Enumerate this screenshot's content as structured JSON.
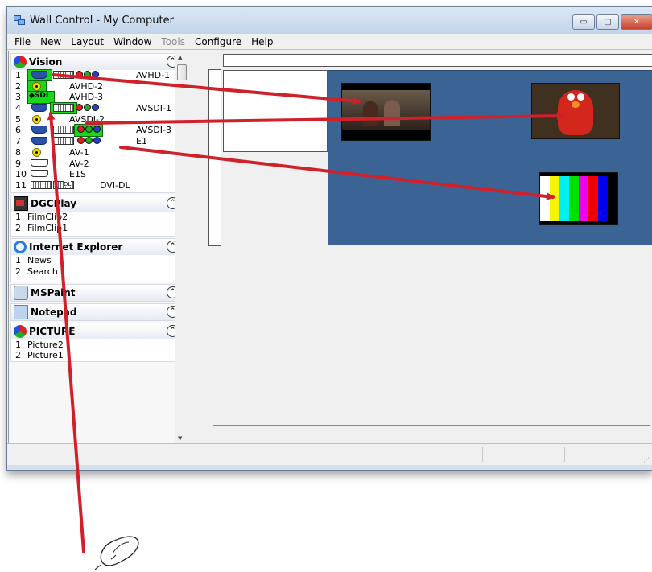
{
  "window": {
    "title": "Wall Control - My Computer",
    "minimize": "▭",
    "maximize": "▢",
    "close": "✕"
  },
  "menu": [
    {
      "label": "File",
      "disabled": false
    },
    {
      "label": "New",
      "disabled": false
    },
    {
      "label": "Layout",
      "disabled": false
    },
    {
      "label": "Window",
      "disabled": false
    },
    {
      "label": "Tools",
      "disabled": true
    },
    {
      "label": "Configure",
      "disabled": false
    },
    {
      "label": "Help",
      "disabled": false
    }
  ],
  "groups": {
    "vision": {
      "title": "Vision",
      "icon": "rgb-circle-icon",
      "collapse": "⌃",
      "items": [
        {
          "n": "1",
          "label": "AVHD-1"
        },
        {
          "n": "2",
          "label": "AVHD-2"
        },
        {
          "n": "3",
          "label": "AVHD-3",
          "tag": "SDI"
        },
        {
          "n": "4",
          "label": "AVSDI-1"
        },
        {
          "n": "5",
          "label": "AVSDI-2"
        },
        {
          "n": "6",
          "label": "AVSDI-3"
        },
        {
          "n": "7",
          "label": "E1"
        },
        {
          "n": "8",
          "label": "AV-1"
        },
        {
          "n": "9",
          "label": "AV-2"
        },
        {
          "n": "10",
          "label": "E1S"
        },
        {
          "n": "11",
          "label": "DVI-DL",
          "tag": "DL"
        }
      ]
    },
    "dgcplay": {
      "title": "DGCPlay",
      "icon": "film-icon",
      "collapse": "⌃",
      "items": [
        {
          "n": "1",
          "label": "FilmClip2"
        },
        {
          "n": "2",
          "label": "FilmClip1"
        }
      ]
    },
    "ie": {
      "title": "Internet Explorer",
      "icon": "internet-explorer-icon",
      "collapse": "⌃",
      "items": [
        {
          "n": "1",
          "label": "News"
        },
        {
          "n": "2",
          "label": "Search"
        }
      ]
    },
    "mspaint": {
      "title": "MSPaint",
      "icon": "paint-icon",
      "collapse": "⌃"
    },
    "notepad": {
      "title": "Notepad",
      "icon": "notepad-icon",
      "collapse": "⌃"
    },
    "picture": {
      "title": "PICTURE",
      "icon": "rgb-circle-icon",
      "collapse": "⌃",
      "items": [
        {
          "n": "1",
          "label": "Picture2"
        },
        {
          "n": "2",
          "label": "Picture1"
        }
      ]
    }
  },
  "colors": {
    "arrow": "#d0202a",
    "wall": "#3b6494",
    "highlight": "#19d719"
  }
}
